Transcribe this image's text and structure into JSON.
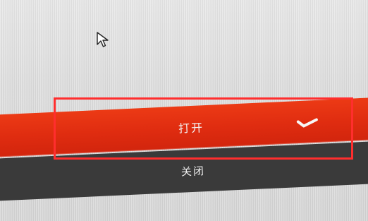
{
  "menu": {
    "items": [
      {
        "label": "打开",
        "selected": true
      },
      {
        "label": "关闭",
        "selected": false
      }
    ]
  },
  "icons": {
    "cursor": "mouse-pointer-icon",
    "check": "checkmark-icon"
  },
  "colors": {
    "selected_background": "#df2c10",
    "unselected_background": "#3a3a3a",
    "highlight_outline": "#ff2e2e",
    "screen_background": "#dcdcdc"
  }
}
